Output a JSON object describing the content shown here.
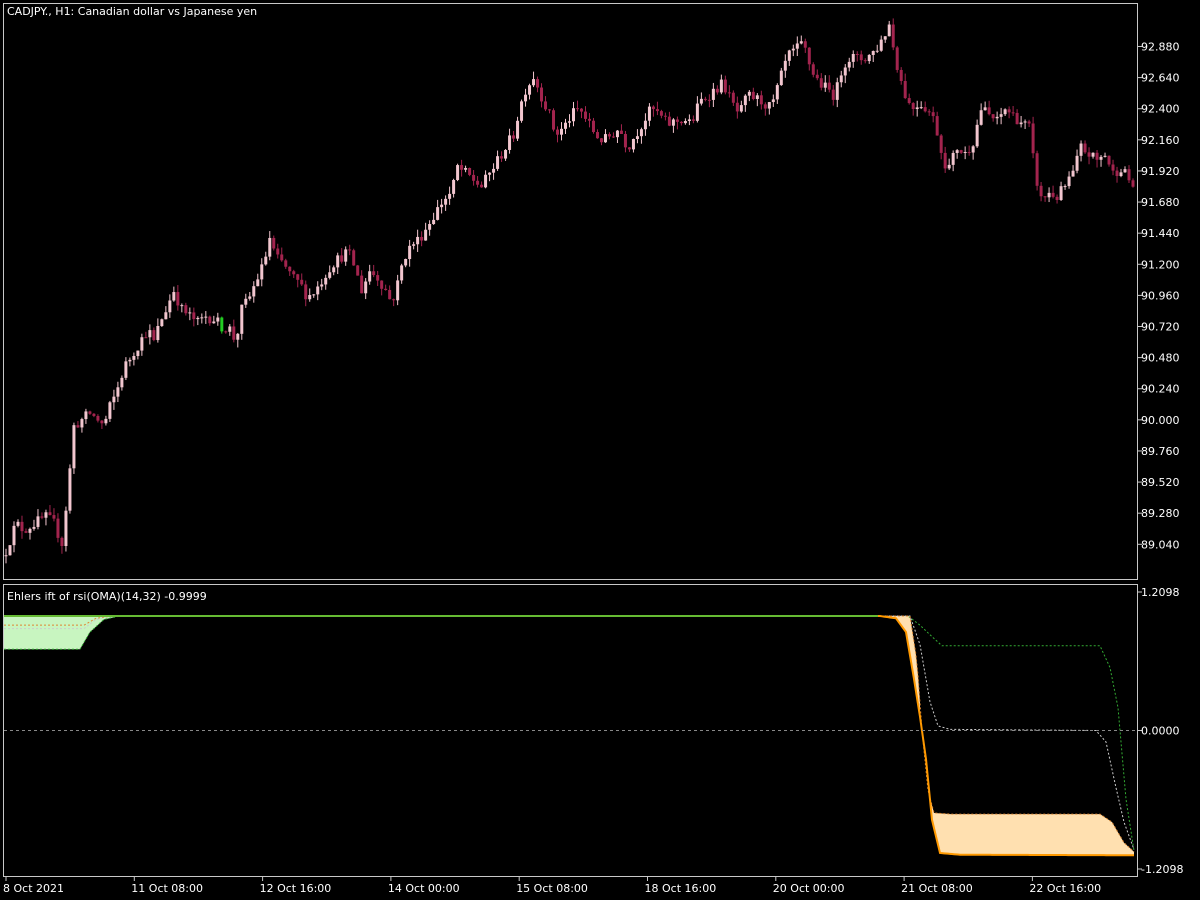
{
  "window": {
    "symbol_title": "CADJPY., H1:  Canadian dollar vs Japanese yen",
    "indicator_title": "Ehlers ift of rsi(OMA)(14,32) -0.9999"
  },
  "colors": {
    "background": "#000000",
    "frame": "#c8c8c8",
    "candle_bull": "#f2c6cf",
    "candle_bear": "#a3244e",
    "candle_highlight": "#22cc22",
    "fill_upper": "#c8f5c0",
    "fill_lower": "#ffe0b0",
    "main_line_up": "#66bb33",
    "main_line_down": "#ff9900",
    "level_upper": "#33aa33",
    "level_middle": "#cccccc",
    "level_lower": "#dd8833",
    "zero_line": "#888888"
  },
  "chart_data": [
    {
      "type": "candlestick",
      "title": "CADJPY., H1:  Canadian dollar vs Japanese yen",
      "y_ticks": [
        "92.880",
        "92.640",
        "92.400",
        "92.160",
        "91.920",
        "91.680",
        "91.440",
        "91.200",
        "90.960",
        "90.720",
        "90.480",
        "90.240",
        "90.000",
        "89.760",
        "89.520",
        "89.280",
        "89.040"
      ],
      "ylim": [
        88.78,
        93.2
      ],
      "close_path": [
        [
          0,
          88.95
        ],
        [
          12,
          89.2
        ],
        [
          20,
          89.15
        ],
        [
          30,
          89.2
        ],
        [
          42,
          89.25
        ],
        [
          50,
          89.2
        ],
        [
          58,
          89.05
        ],
        [
          64,
          89.45
        ],
        [
          70,
          89.95
        ],
        [
          78,
          90.0
        ],
        [
          86,
          90.05
        ],
        [
          94,
          90.0
        ],
        [
          100,
          89.95
        ],
        [
          106,
          90.1
        ],
        [
          112,
          90.2
        ],
        [
          120,
          90.4
        ],
        [
          128,
          90.5
        ],
        [
          136,
          90.6
        ],
        [
          144,
          90.7
        ],
        [
          150,
          90.6
        ],
        [
          156,
          90.75
        ],
        [
          162,
          90.85
        ],
        [
          170,
          91.0
        ],
        [
          178,
          90.85
        ],
        [
          186,
          90.8
        ],
        [
          194,
          90.75
        ],
        [
          202,
          90.8
        ],
        [
          210,
          90.78
        ],
        [
          218,
          90.72
        ],
        [
          226,
          90.7
        ],
        [
          232,
          90.6
        ],
        [
          238,
          90.85
        ],
        [
          246,
          90.95
        ],
        [
          254,
          91.1
        ],
        [
          260,
          91.2
        ],
        [
          266,
          91.4
        ],
        [
          272,
          91.25
        ],
        [
          280,
          91.2
        ],
        [
          288,
          91.1
        ],
        [
          296,
          91.05
        ],
        [
          304,
          90.95
        ],
        [
          312,
          91.0
        ],
        [
          320,
          91.1
        ],
        [
          328,
          91.2
        ],
        [
          336,
          91.25
        ],
        [
          344,
          91.3
        ],
        [
          350,
          91.2
        ],
        [
          358,
          91.0
        ],
        [
          366,
          91.15
        ],
        [
          374,
          91.1
        ],
        [
          382,
          91.0
        ],
        [
          388,
          90.9
        ],
        [
          394,
          91.05
        ],
        [
          400,
          91.25
        ],
        [
          408,
          91.35
        ],
        [
          416,
          91.4
        ],
        [
          424,
          91.5
        ],
        [
          432,
          91.6
        ],
        [
          440,
          91.7
        ],
        [
          448,
          91.75
        ],
        [
          454,
          91.95
        ],
        [
          462,
          91.9
        ],
        [
          470,
          91.85
        ],
        [
          478,
          91.8
        ],
        [
          486,
          91.9
        ],
        [
          494,
          92.0
        ],
        [
          502,
          92.1
        ],
        [
          510,
          92.2
        ],
        [
          516,
          92.4
        ],
        [
          522,
          92.55
        ],
        [
          530,
          92.65
        ],
        [
          538,
          92.5
        ],
        [
          546,
          92.35
        ],
        [
          552,
          92.2
        ],
        [
          560,
          92.25
        ],
        [
          568,
          92.35
        ],
        [
          576,
          92.4
        ],
        [
          584,
          92.3
        ],
        [
          592,
          92.2
        ],
        [
          600,
          92.15
        ],
        [
          608,
          92.2
        ],
        [
          616,
          92.25
        ],
        [
          624,
          92.1
        ],
        [
          632,
          92.2
        ],
        [
          640,
          92.3
        ],
        [
          648,
          92.4
        ],
        [
          656,
          92.35
        ],
        [
          664,
          92.28
        ],
        [
          672,
          92.3
        ],
        [
          680,
          92.32
        ],
        [
          688,
          92.28
        ],
        [
          696,
          92.45
        ],
        [
          704,
          92.5
        ],
        [
          712,
          92.55
        ],
        [
          720,
          92.6
        ],
        [
          728,
          92.45
        ],
        [
          736,
          92.35
        ],
        [
          744,
          92.5
        ],
        [
          752,
          92.48
        ],
        [
          760,
          92.45
        ],
        [
          768,
          92.4
        ],
        [
          776,
          92.6
        ],
        [
          784,
          92.8
        ],
        [
          792,
          92.85
        ],
        [
          800,
          92.9
        ],
        [
          808,
          92.7
        ],
        [
          816,
          92.6
        ],
        [
          824,
          92.55
        ],
        [
          832,
          92.5
        ],
        [
          840,
          92.75
        ],
        [
          848,
          92.8
        ],
        [
          856,
          92.78
        ],
        [
          864,
          92.8
        ],
        [
          872,
          92.85
        ],
        [
          880,
          92.95
        ],
        [
          886,
          93.05
        ],
        [
          892,
          92.8
        ],
        [
          900,
          92.55
        ],
        [
          908,
          92.4
        ],
        [
          916,
          92.45
        ],
        [
          924,
          92.4
        ],
        [
          932,
          92.3
        ],
        [
          940,
          92.0
        ],
        [
          946,
          91.95
        ],
        [
          954,
          92.1
        ],
        [
          962,
          92.05
        ],
        [
          970,
          92.15
        ],
        [
          978,
          92.4
        ],
        [
          986,
          92.35
        ],
        [
          994,
          92.3
        ],
        [
          1002,
          92.4
        ],
        [
          1010,
          92.35
        ],
        [
          1018,
          92.3
        ],
        [
          1026,
          92.25
        ],
        [
          1032,
          91.9
        ],
        [
          1038,
          91.7
        ],
        [
          1046,
          91.75
        ],
        [
          1054,
          91.72
        ],
        [
          1062,
          91.8
        ],
        [
          1070,
          91.9
        ],
        [
          1078,
          92.1
        ],
        [
          1086,
          92.05
        ],
        [
          1094,
          92.0
        ],
        [
          1102,
          92.05
        ],
        [
          1110,
          91.9
        ],
        [
          1118,
          91.95
        ],
        [
          1126,
          91.85
        ],
        [
          1134,
          91.75
        ]
      ]
    },
    {
      "type": "line",
      "title": "Ehlers ift of rsi(OMA)(14,32) -0.9999",
      "y_ticks": [
        "1.2098",
        "0.0000",
        "-1.2098"
      ],
      "ylim": [
        -1.2098,
        1.2098
      ],
      "series": [
        {
          "values": [
            [
              0,
              1.0
            ],
            [
              880,
              1.0
            ],
            [
              896,
              0.98
            ],
            [
              906,
              0.86
            ],
            [
              914,
              0.45
            ],
            [
              920,
              0.12
            ],
            [
              926,
              -0.25
            ],
            [
              932,
              -0.78
            ],
            [
              940,
              -1.07
            ],
            [
              960,
              -1.085
            ],
            [
              1134,
              -1.09
            ]
          ]
        },
        {
          "values": [
            [
              0,
              0.71
            ],
            [
              80,
              0.71
            ],
            [
              90,
              0.86
            ],
            [
              104,
              0.97
            ],
            [
              120,
              1.0
            ],
            [
              908,
              1.0
            ],
            [
              920,
              0.92
            ],
            [
              932,
              0.82
            ],
            [
              942,
              0.74
            ],
            [
              1000,
              0.74
            ],
            [
              1100,
              0.74
            ],
            [
              1110,
              0.55
            ],
            [
              1118,
              0.2
            ],
            [
              1126,
              -0.6
            ],
            [
              1134,
              -1.05
            ]
          ]
        },
        {
          "values": [
            [
              0,
              0.89
            ],
            [
              84,
              0.89
            ],
            [
              96,
              0.97
            ],
            [
              110,
              1.0
            ],
            [
              910,
              1.0
            ],
            [
              920,
              0.75
            ],
            [
              930,
              0.25
            ],
            [
              938,
              0.04
            ],
            [
              950,
              0.01
            ],
            [
              1096,
              0.0
            ],
            [
              1106,
              -0.1
            ],
            [
              1116,
              -0.5
            ],
            [
              1124,
              -0.8
            ],
            [
              1134,
              -1.04
            ]
          ]
        },
        {
          "values": [
            [
              0,
              0.92
            ],
            [
              84,
              0.92
            ],
            [
              96,
              0.98
            ],
            [
              112,
              1.0
            ],
            [
              910,
              1.0
            ],
            [
              917,
              0.6
            ],
            [
              922,
              0.0
            ],
            [
              928,
              -0.52
            ],
            [
              934,
              -0.72
            ],
            [
              950,
              -0.73
            ],
            [
              1100,
              -0.73
            ],
            [
              1112,
              -0.8
            ],
            [
              1124,
              -0.98
            ],
            [
              1134,
              -1.06
            ]
          ]
        }
      ]
    }
  ],
  "x_axis": {
    "labels": [
      "8 Oct 2021",
      "11 Oct 08:00",
      "12 Oct 16:00",
      "14 Oct 00:00",
      "15 Oct 08:00",
      "18 Oct 16:00",
      "20 Oct 00:00",
      "21 Oct 08:00",
      "22 Oct 16:00"
    ]
  }
}
